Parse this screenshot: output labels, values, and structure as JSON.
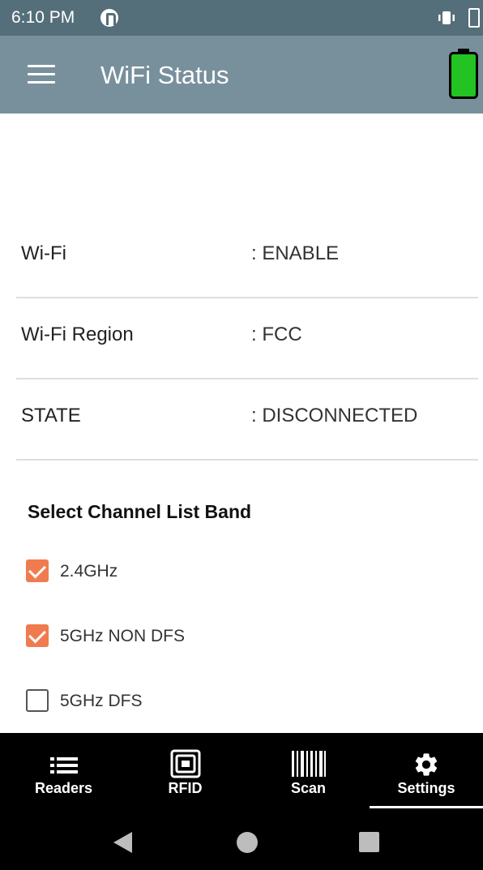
{
  "status_bar": {
    "time": "6:10 PM",
    "icons": [
      "app-notification-icon",
      "vibrate-icon",
      "battery-icon"
    ]
  },
  "app_bar": {
    "title": "WiFi Status",
    "icons": [
      "menu-icon",
      "battery-full-icon"
    ],
    "colors": {
      "toolbar": "#78909c",
      "status": "#546e7a",
      "battery": "#22c322"
    }
  },
  "info": {
    "wifi": {
      "label": "Wi-Fi",
      "value": ": ENABLE"
    },
    "region": {
      "label": "Wi-Fi Region",
      "value": ": FCC"
    },
    "state": {
      "label": "STATE",
      "value": ": DISCONNECTED"
    }
  },
  "band": {
    "title": "Select Channel List Band",
    "options": [
      {
        "label": "2.4GHz",
        "checked": true
      },
      {
        "label": "5GHz NON DFS",
        "checked": true
      },
      {
        "label": "5GHz DFS",
        "checked": false
      }
    ],
    "accent_color": "#f07b4f"
  },
  "bottom_nav": {
    "items": [
      {
        "label": "Readers",
        "icon": "list-icon"
      },
      {
        "label": "RFID",
        "icon": "rfid-tag-icon"
      },
      {
        "label": "Scan",
        "icon": "barcode-icon"
      },
      {
        "label": "Settings",
        "icon": "gear-icon",
        "selected": true
      }
    ]
  },
  "system_nav": {
    "icons": [
      "back-icon",
      "home-icon",
      "recents-icon"
    ]
  }
}
